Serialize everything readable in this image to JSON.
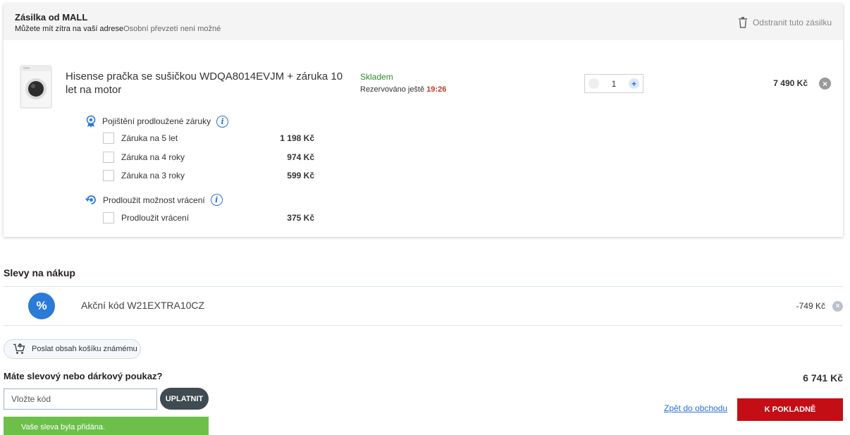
{
  "shipment": {
    "title": "Zásilka od MALL",
    "delivery_text": "Můžete mít zítra na vaší adrese",
    "pickup_text": "Osobní převzetí není možné",
    "remove_label": "Odstranit tuto zásilku"
  },
  "product": {
    "name": "Hisense pračka se sušičkou WDQA8014EVJM + záruka 10 let na motor",
    "stock_status": "Skladem",
    "reserved_label": "Rezervováno ještě",
    "reserved_time": "19:26",
    "quantity": "1",
    "price": "7 490 Kč"
  },
  "warranty": {
    "heading": "Pojištění prodloužené záruky",
    "options": [
      {
        "label": "Záruka na 5 let",
        "price": "1 198 Kč"
      },
      {
        "label": "Záruka na 4 roky",
        "price": "974 Kč"
      },
      {
        "label": "Záruka na 3 roky",
        "price": "599 Kč"
      }
    ]
  },
  "returns": {
    "heading": "Prodloužit možnost vrácení",
    "options": [
      {
        "label": "Prodloužit vrácení",
        "price": "375 Kč"
      }
    ]
  },
  "discounts": {
    "section_title": "Slevy na nákup",
    "icon_symbol": "%",
    "code_label": "Akční kód W21EXTRA10CZ",
    "amount": "-749 Kč"
  },
  "share": {
    "label": "Poslat obsah košíku známému"
  },
  "voucher": {
    "title": "Máte slevový nebo dárkový poukaz?",
    "placeholder": "Vložte kód",
    "apply_label": "UPLATNIT",
    "success_message": "Vaše sleva byla přidána."
  },
  "summary": {
    "total": "6 741 Kč",
    "back_label": "Zpět do obchodu",
    "checkout_label": "K POKLADNĚ"
  },
  "colors": {
    "accent_blue": "#2a6fdb",
    "stock_green": "#2e8a2e",
    "timer_red": "#c0392b",
    "checkout_red": "#c40e15",
    "success_green": "#6cc04a"
  }
}
